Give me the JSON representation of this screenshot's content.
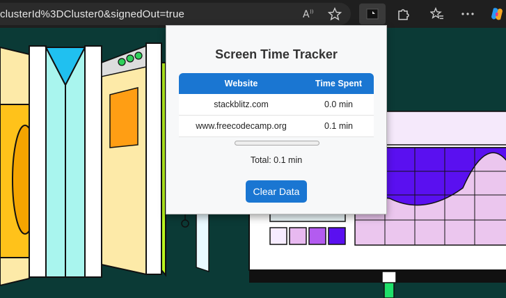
{
  "browser": {
    "address_text": "clusterId%3DCluster0&signedOut=true",
    "icons": [
      "read-aloud-icon",
      "favorite-star-icon",
      "extension-tracker-icon",
      "extensions-puzzle-icon",
      "favorites-list-icon",
      "more-icon",
      "copilot-icon"
    ]
  },
  "popup": {
    "title": "Screen Time Tracker",
    "columns": [
      "Website",
      "Time Spent"
    ],
    "rows": [
      {
        "website": "stackblitz.com",
        "time": "0.0 min"
      },
      {
        "website": "www.freecodecamp.org",
        "time": "0.1 min"
      }
    ],
    "total": "Total: 0.1 min",
    "clear_button": "Clear Data"
  },
  "colors": {
    "accent": "#1a76d2",
    "background": "#0b3a36"
  }
}
